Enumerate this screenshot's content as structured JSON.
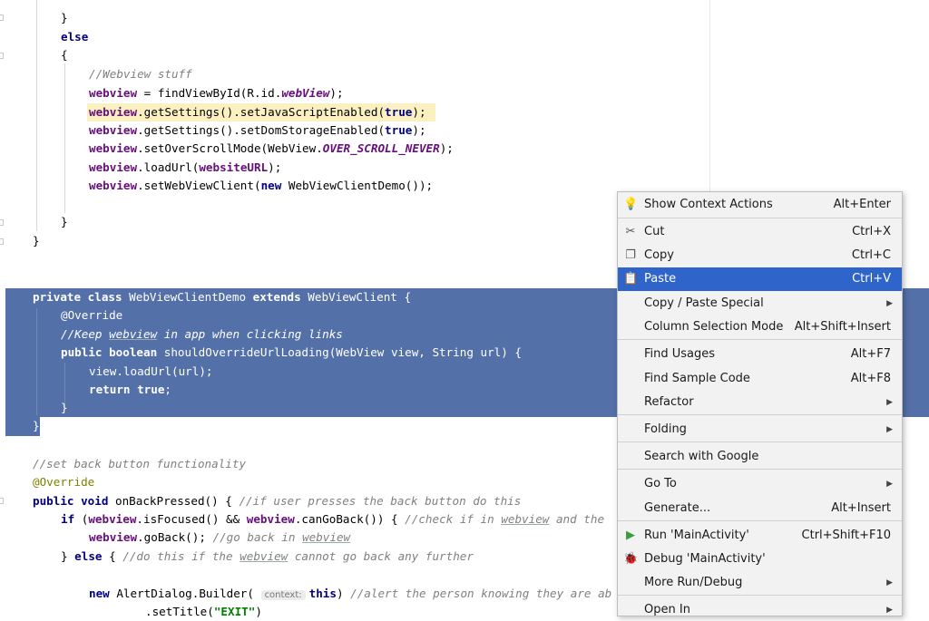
{
  "editor": {
    "l1": "}",
    "l2": "else",
    "l3": "{",
    "l4_comment": "//Webview stuff",
    "l5_a": "webview",
    "l5_b": " = findViewById(R.id.",
    "l5_c": "webView",
    "l5_d": ");",
    "l6_a": "webview",
    "l6_b": ".getSettings().setJavaScriptEnabled(",
    "l6_c": "true",
    "l6_d": ");",
    "l7_a": "webview",
    "l7_b": ".getSettings().setDomStorageEnabled(",
    "l7_c": "true",
    "l7_d": ");",
    "l8_a": "webview",
    "l8_b": ".setOverScrollMode(WebView.",
    "l8_c": "OVER_SCROLL_NEVER",
    "l8_d": ");",
    "l9_a": "webview",
    "l9_b": ".loadUrl(",
    "l9_c": "websiteURL",
    "l9_d": ");",
    "l10_a": "webview",
    "l10_b": ".setWebViewClient(",
    "l10_c": "new",
    "l10_d": " WebViewClientDemo());",
    "l11": "}",
    "l12": "}",
    "s1_a": "private class",
    "s1_b": " WebViewClientDemo ",
    "s1_c": "extends",
    "s1_d": " WebViewClient {",
    "s2": "@Override",
    "s3_a": "//Keep ",
    "s3_b": "webview",
    "s3_c": " in app when clicking links",
    "s4_a": "public boolean",
    "s4_b": " shouldOverrideUrlLoading(WebView view, String url) {",
    "s5": "view.loadUrl(url);",
    "s6_a": "return true",
    "s6_b": ";",
    "s7": "}",
    "s8": "}",
    "b1": "//set back button functionality",
    "b2": "@Override",
    "b3_a": "public void",
    "b3_b": " onBackPressed() { ",
    "b3_c": "//if user presses the back button do this",
    "b4_a": "if",
    "b4_b": " (",
    "b4_c": "webview",
    "b4_d": ".isFocused() && ",
    "b4_e": "webview",
    "b4_f": ".canGoBack()) { ",
    "b4_g": "//check if in ",
    "b4_h": "webview",
    "b4_i": " and the",
    "b5_a": "webview",
    "b5_b": ".goBack(); ",
    "b5_c": "//go back in ",
    "b5_d": "webview",
    "b6_a": "} ",
    "b6_b": "else",
    "b6_c": " { ",
    "b6_d": "//do this if the ",
    "b6_e": "webview",
    "b6_f": " cannot go back any further",
    "b7_a": "new",
    "b7_b": " AlertDialog.Builder( ",
    "b7_hint": "context:",
    "b7_c": "this",
    "b7_d": ") ",
    "b7_e": "//alert the person knowing they are ab",
    "b8_a": ".setTitle(",
    "b8_b": "\"EXIT\"",
    "b8_c": ")"
  },
  "menu": {
    "items": [
      {
        "icon": "lightbulb-icon",
        "glyph": "💡",
        "label": "Show Context Actions",
        "shortcut": "Alt+Enter",
        "submenu": false
      },
      {
        "icon": "scissors-icon",
        "glyph": "✂",
        "label": "Cut",
        "shortcut": "Ctrl+X",
        "submenu": false
      },
      {
        "icon": "copy-icon",
        "glyph": "❐",
        "label": "Copy",
        "shortcut": "Ctrl+C",
        "submenu": false
      },
      {
        "icon": "clipboard-icon",
        "glyph": "📋",
        "label": "Paste",
        "shortcut": "Ctrl+V",
        "submenu": false
      },
      {
        "icon": "",
        "glyph": "",
        "label": "Copy / Paste Special",
        "shortcut": "",
        "submenu": true
      },
      {
        "icon": "",
        "glyph": "",
        "label": "Column Selection Mode",
        "shortcut": "Alt+Shift+Insert",
        "submenu": false
      },
      {
        "icon": "",
        "glyph": "",
        "label": "Find Usages",
        "shortcut": "Alt+F7",
        "submenu": false
      },
      {
        "icon": "",
        "glyph": "",
        "label": "Find Sample Code",
        "shortcut": "Alt+F8",
        "submenu": false
      },
      {
        "icon": "",
        "glyph": "",
        "label": "Refactor",
        "shortcut": "",
        "submenu": true
      },
      {
        "icon": "",
        "glyph": "",
        "label": "Folding",
        "shortcut": "",
        "submenu": true
      },
      {
        "icon": "",
        "glyph": "",
        "label": "Search with Google",
        "shortcut": "",
        "submenu": false
      },
      {
        "icon": "",
        "glyph": "",
        "label": "Go To",
        "shortcut": "",
        "submenu": true
      },
      {
        "icon": "",
        "glyph": "",
        "label": "Generate...",
        "shortcut": "Alt+Insert",
        "submenu": false
      },
      {
        "icon": "run-icon",
        "glyph": "▶",
        "label": "Run 'MainActivity'",
        "shortcut": "Ctrl+Shift+F10",
        "submenu": false
      },
      {
        "icon": "debug-icon",
        "glyph": "🐞",
        "label": "Debug 'MainActivity'",
        "shortcut": "",
        "submenu": false
      },
      {
        "icon": "",
        "glyph": "",
        "label": "More Run/Debug",
        "shortcut": "",
        "submenu": true
      },
      {
        "icon": "",
        "glyph": "",
        "label": "Open In",
        "shortcut": "",
        "submenu": true
      }
    ],
    "active_label": "Paste",
    "accent_color": "#2f65ca",
    "selection_color": "#5470a8"
  }
}
